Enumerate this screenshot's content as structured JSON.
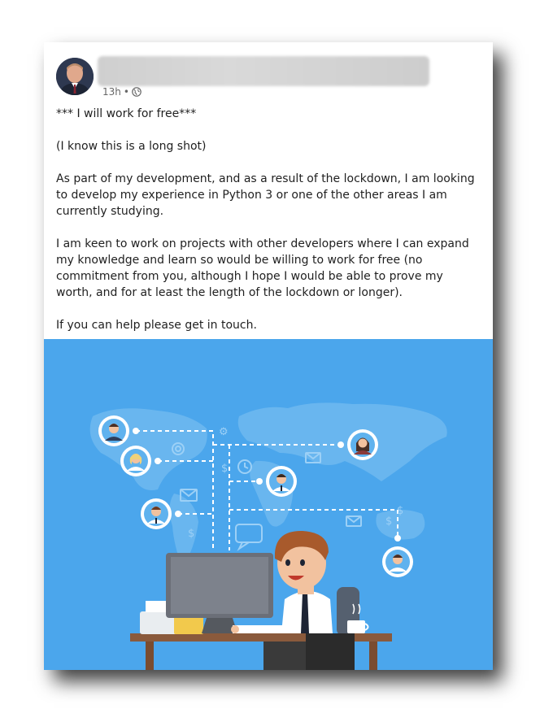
{
  "post": {
    "timestamp": "13h",
    "separator": "•",
    "visibility_icon": "globe-icon",
    "paragraphs": [
      "*** I will work for free***",
      "(I know this is a long shot)",
      "As part of my development, and as a result of the lockdown, I am looking to develop my experience in Python 3 or one of the other areas I am currently studying.",
      "I am keen to work on projects with other developers where I can expand my knowledge and learn so would be willing to work for free (no commitment from you, although I hope I would be able to prove my worth, and for at least the length of the lockdown or longer).",
      "If you can help please get in touch."
    ]
  },
  "illustration": {
    "background": "#4ba6ec",
    "map_color": "#6db8f0",
    "accent_line": "#ffffff"
  }
}
